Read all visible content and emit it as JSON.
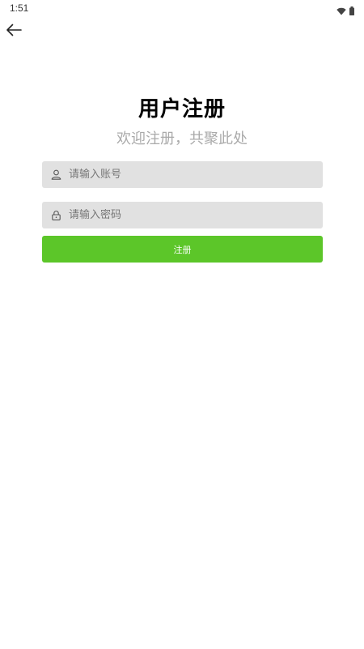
{
  "status_bar": {
    "time": "1:51"
  },
  "nav": {
    "back_icon": "arrow-left-icon"
  },
  "header": {
    "title": "用户注册",
    "subtitle": "欢迎注册，共聚此处"
  },
  "form": {
    "account": {
      "icon": "user-icon",
      "value": "",
      "placeholder": "请输入账号"
    },
    "password": {
      "icon": "lock-icon",
      "value": "",
      "placeholder": "请输入密码"
    },
    "submit_label": "注册"
  },
  "colors": {
    "accent": "#5cc629",
    "field_bg": "#e1e1e1",
    "subtitle": "#aaaaaa"
  }
}
